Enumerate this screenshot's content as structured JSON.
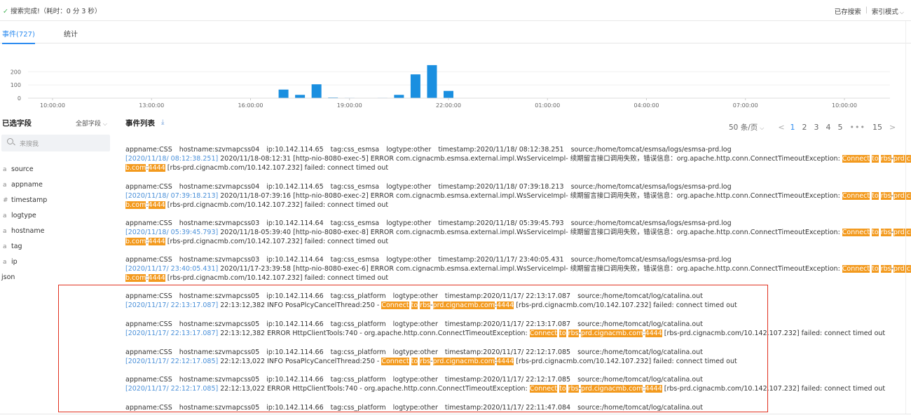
{
  "status": {
    "check_icon": "check-icon",
    "text": "搜索完成!（耗时：0 分 3 秒）"
  },
  "top_actions": {
    "saved_search": "已存搜索",
    "separator": "|",
    "index_mode": "索引模式"
  },
  "tabs": [
    {
      "label": "事件(727)",
      "active": true
    },
    {
      "label": "统计",
      "active": false
    }
  ],
  "chart_data": {
    "type": "bar",
    "y_ticks": [
      "200",
      "100",
      "0"
    ],
    "ylim": [
      0,
      260
    ],
    "x_ticks": [
      "10:00:00",
      "13:00:00",
      "16:00:00",
      "19:00:00",
      "22:00:00",
      "01:00:00",
      "04:00:00",
      "07:00:00",
      "10:00:00"
    ],
    "x_hours_from_start": [
      0,
      3,
      6,
      9,
      12,
      15,
      18,
      21,
      24
    ],
    "bars": [
      {
        "t": 5.5,
        "value": 2
      },
      {
        "t": 6.5,
        "value": 2
      },
      {
        "t": 7.0,
        "value": 65
      },
      {
        "t": 7.5,
        "value": 25
      },
      {
        "t": 8.0,
        "value": 105
      },
      {
        "t": 8.5,
        "value": 5
      },
      {
        "t": 9.0,
        "value": 3
      },
      {
        "t": 10.0,
        "value": 3
      },
      {
        "t": 10.5,
        "value": 25
      },
      {
        "t": 11.0,
        "value": 180
      },
      {
        "t": 11.5,
        "value": 250
      },
      {
        "t": 12.0,
        "value": 55
      }
    ],
    "bar_color": "#1a8fe0"
  },
  "sidebar": {
    "title": "已选字段",
    "all_fields": "全部字段",
    "search_placeholder": "来搜我",
    "fields": [
      {
        "type": "a",
        "name": "source"
      },
      {
        "type": "a",
        "name": "appname"
      },
      {
        "type": "#",
        "name": "timestamp"
      },
      {
        "type": "a",
        "name": "logtype"
      },
      {
        "type": "a",
        "name": "hostname"
      },
      {
        "type": "a",
        "name": "tag"
      },
      {
        "type": "a",
        "name": "ip"
      },
      {
        "type": "",
        "name": "json"
      }
    ]
  },
  "events_title": "事件列表",
  "pager": {
    "per_page": "50 条/页",
    "prev": "<",
    "pages": [
      "1",
      "2",
      "3",
      "4",
      "5"
    ],
    "current": "1",
    "dots": "•••",
    "last": "15",
    "next": ">"
  },
  "highlight_color": "#f39a1e",
  "box_color": "#e0301e",
  "events": [
    {
      "meta": [
        "appname:CSS",
        "hostname:szvmapcss04",
        "ip:10.142.114.65",
        "tag:css_esmsa",
        "logtype:other",
        "timestamp:2020/11/18/ 08:12:38.251",
        "source:/home/tomcat/esmsa/logs/esmsa-prd.log"
      ],
      "lines": [
        [
          {
            "t": "[2020/11/18/ 08:12:38.251]",
            "c": "ts"
          },
          {
            "t": " 2020/11/18-08:12:31 [http-nio-8080-exec-5] ERROR com.cignacmb.esmsa.external.impl.WsServiceImpl- 续期留言接口调用失败，错误信息：org.apache.http.conn.ConnectTimeoutException: ",
            "c": ""
          },
          {
            "t": "Connect",
            "c": "hl"
          },
          {
            "t": " ",
            "c": ""
          },
          {
            "t": "to",
            "c": "hl"
          },
          {
            "t": " ",
            "c": ""
          },
          {
            "t": "rbs",
            "c": "hl"
          },
          {
            "t": "-",
            "c": ""
          },
          {
            "t": "prd.cignacm",
            "c": "hl"
          }
        ],
        [
          {
            "t": "b.com",
            "c": "hl"
          },
          {
            "t": ":",
            "c": ""
          },
          {
            "t": "4444",
            "c": "hl"
          },
          {
            "t": " [rbs-prd.cignacmb.com/10.142.107.232] failed: connect timed out",
            "c": ""
          }
        ]
      ]
    },
    {
      "meta": [
        "appname:CSS",
        "hostname:szvmapcss04",
        "ip:10.142.114.65",
        "tag:css_esmsa",
        "logtype:other",
        "timestamp:2020/11/18/ 07:39:18.213",
        "source:/home/tomcat/esmsa/logs/esmsa-prd.log"
      ],
      "lines": [
        [
          {
            "t": "[2020/11/18/ 07:39:18.213]",
            "c": "ts"
          },
          {
            "t": " 2020/11/18-07:39:16 [http-nio-8080-exec-2] ERROR com.cignacmb.esmsa.external.impl.WsServiceImpl- 续期留言接口调用失败，错误信息：org.apache.http.conn.ConnectTimeoutException: ",
            "c": ""
          },
          {
            "t": "Connect",
            "c": "hl"
          },
          {
            "t": " ",
            "c": ""
          },
          {
            "t": "to",
            "c": "hl"
          },
          {
            "t": " ",
            "c": ""
          },
          {
            "t": "rbs",
            "c": "hl"
          },
          {
            "t": "-",
            "c": ""
          },
          {
            "t": "prd.cignacm",
            "c": "hl"
          }
        ],
        [
          {
            "t": "b.com",
            "c": "hl"
          },
          {
            "t": ":",
            "c": ""
          },
          {
            "t": "4444",
            "c": "hl"
          },
          {
            "t": " [rbs-prd.cignacmb.com/10.142.107.232] failed: connect timed out",
            "c": ""
          }
        ]
      ]
    },
    {
      "meta": [
        "appname:CSS",
        "hostname:szvmapcss03",
        "ip:10.142.114.64",
        "tag:css_esmsa",
        "logtype:other",
        "timestamp:2020/11/18/ 05:39:45.793",
        "source:/home/tomcat/esmsa/logs/esmsa-prd.log"
      ],
      "lines": [
        [
          {
            "t": "[2020/11/18/ 05:39:45.793]",
            "c": "ts"
          },
          {
            "t": " 2020/11/18-05:39:40 [http-nio-8080-exec-8] ERROR com.cignacmb.esmsa.external.impl.WsServiceImpl- 续期留言接口调用失败，错误信息：org.apache.http.conn.ConnectTimeoutException: ",
            "c": ""
          },
          {
            "t": "Connect",
            "c": "hl"
          },
          {
            "t": " ",
            "c": ""
          },
          {
            "t": "to",
            "c": "hl"
          },
          {
            "t": " ",
            "c": ""
          },
          {
            "t": "rbs",
            "c": "hl"
          },
          {
            "t": "-",
            "c": ""
          },
          {
            "t": "prd.cignacm",
            "c": "hl"
          }
        ],
        [
          {
            "t": "b.com",
            "c": "hl"
          },
          {
            "t": ":",
            "c": ""
          },
          {
            "t": "4444",
            "c": "hl"
          },
          {
            "t": " [rbs-prd.cignacmb.com/10.142.107.232] failed: connect timed out",
            "c": ""
          }
        ]
      ]
    },
    {
      "meta": [
        "appname:CSS",
        "hostname:szvmapcss03",
        "ip:10.142.114.64",
        "tag:css_esmsa",
        "logtype:other",
        "timestamp:2020/11/17/ 23:40:05.431",
        "source:/home/tomcat/esmsa/logs/esmsa-prd.log"
      ],
      "lines": [
        [
          {
            "t": "[2020/11/17/ 23:40:05.431]",
            "c": "ts"
          },
          {
            "t": " 2020/11/17-23:39:58 [http-nio-8080-exec-6] ERROR com.cignacmb.esmsa.external.impl.WsServiceImpl- 续期留言接口调用失败，错误信息：org.apache.http.conn.ConnectTimeoutException: ",
            "c": ""
          },
          {
            "t": "Connect",
            "c": "hl"
          },
          {
            "t": " ",
            "c": ""
          },
          {
            "t": "to",
            "c": "hl"
          },
          {
            "t": " ",
            "c": ""
          },
          {
            "t": "rbs",
            "c": "hl"
          },
          {
            "t": "-",
            "c": ""
          },
          {
            "t": "prd.cignacm",
            "c": "hl"
          }
        ],
        [
          {
            "t": "b.com",
            "c": "hl"
          },
          {
            "t": ":",
            "c": ""
          },
          {
            "t": "4444",
            "c": "hl"
          },
          {
            "t": " [rbs-prd.cignacmb.com/10.142.107.232] failed: connect timed out",
            "c": ""
          }
        ]
      ]
    },
    {
      "meta": [
        "appname:CSS",
        "hostname:szvmapcss05",
        "ip:10.142.114.66",
        "tag:css_platform",
        "logtype:other",
        "timestamp:2020/11/17/ 22:13:17.087",
        "source:/home/tomcat/log/catalina.out"
      ],
      "lines": [
        [
          {
            "t": "[2020/11/17/ 22:13:17.087]",
            "c": "ts"
          },
          {
            "t": " 22:13:12,382  INFO PosaPlcyCancelThread:250 - ",
            "c": ""
          },
          {
            "t": "Connect",
            "c": "hl"
          },
          {
            "t": " ",
            "c": ""
          },
          {
            "t": "to",
            "c": "hl"
          },
          {
            "t": " ",
            "c": ""
          },
          {
            "t": "rbs",
            "c": "hl"
          },
          {
            "t": "-",
            "c": ""
          },
          {
            "t": "prd.cignacmb.com",
            "c": "hl"
          },
          {
            "t": ":",
            "c": ""
          },
          {
            "t": "4444",
            "c": "hl"
          },
          {
            "t": " [rbs-prd.cignacmb.com/10.142.107.232] failed: connect timed out",
            "c": ""
          }
        ]
      ]
    },
    {
      "meta": [
        "appname:CSS",
        "hostname:szvmapcss05",
        "ip:10.142.114.66",
        "tag:css_platform",
        "logtype:other",
        "timestamp:2020/11/17/ 22:13:17.087",
        "source:/home/tomcat/log/catalina.out"
      ],
      "lines": [
        [
          {
            "t": "[2020/11/17/ 22:13:17.087]",
            "c": "ts"
          },
          {
            "t": " 22:13:12,382 ERROR HttpClientTools:740 - org.apache.http.conn.ConnectTimeoutException: ",
            "c": ""
          },
          {
            "t": "Connect",
            "c": "hl"
          },
          {
            "t": " ",
            "c": ""
          },
          {
            "t": "to",
            "c": "hl"
          },
          {
            "t": " ",
            "c": ""
          },
          {
            "t": "rbs",
            "c": "hl"
          },
          {
            "t": "-",
            "c": ""
          },
          {
            "t": "prd.cignacmb.com",
            "c": "hl"
          },
          {
            "t": ":",
            "c": ""
          },
          {
            "t": "4444",
            "c": "hl"
          },
          {
            "t": " [rbs-prd.cignacmb.com/10.142.107.232] failed: connect timed out",
            "c": ""
          }
        ]
      ]
    },
    {
      "meta": [
        "appname:CSS",
        "hostname:szvmapcss05",
        "ip:10.142.114.66",
        "tag:css_platform",
        "logtype:other",
        "timestamp:2020/11/17/ 22:12:17.085",
        "source:/home/tomcat/log/catalina.out"
      ],
      "lines": [
        [
          {
            "t": "[2020/11/17/ 22:12:17.085]",
            "c": "ts"
          },
          {
            "t": " 22:12:13,022  INFO PosaPlcyCancelThread:250 - ",
            "c": ""
          },
          {
            "t": "Connect",
            "c": "hl"
          },
          {
            "t": " ",
            "c": ""
          },
          {
            "t": "to",
            "c": "hl"
          },
          {
            "t": " ",
            "c": ""
          },
          {
            "t": "rbs",
            "c": "hl"
          },
          {
            "t": "-",
            "c": ""
          },
          {
            "t": "prd.cignacmb.com",
            "c": "hl"
          },
          {
            "t": ":",
            "c": ""
          },
          {
            "t": "4444",
            "c": "hl"
          },
          {
            "t": " [rbs-prd.cignacmb.com/10.142.107.232] failed: connect timed out",
            "c": ""
          }
        ]
      ]
    },
    {
      "meta": [
        "appname:CSS",
        "hostname:szvmapcss05",
        "ip:10.142.114.66",
        "tag:css_platform",
        "logtype:other",
        "timestamp:2020/11/17/ 22:12:17.085",
        "source:/home/tomcat/log/catalina.out"
      ],
      "lines": [
        [
          {
            "t": "[2020/11/17/ 22:12:17.085]",
            "c": "ts"
          },
          {
            "t": " 22:12:13,022 ERROR HttpClientTools:740 - org.apache.http.conn.ConnectTimeoutException: ",
            "c": ""
          },
          {
            "t": "Connect",
            "c": "hl"
          },
          {
            "t": " ",
            "c": ""
          },
          {
            "t": "to",
            "c": "hl"
          },
          {
            "t": " ",
            "c": ""
          },
          {
            "t": "rbs",
            "c": "hl"
          },
          {
            "t": "-",
            "c": ""
          },
          {
            "t": "prd.cignacmb.com",
            "c": "hl"
          },
          {
            "t": ":",
            "c": ""
          },
          {
            "t": "4444",
            "c": "hl"
          },
          {
            "t": " [rbs-prd.cignacmb.com/10.142.107.232] failed: connect timed out",
            "c": ""
          }
        ]
      ]
    },
    {
      "meta": [
        "appname:CSS",
        "hostname:szvmapcss05",
        "ip:10.142.114.66",
        "tag:css_platform",
        "logtype:other",
        "timestamp:2020/11/17/ 22:11:47.084",
        "source:/home/tomcat/log/catalina.out"
      ],
      "lines": []
    }
  ]
}
